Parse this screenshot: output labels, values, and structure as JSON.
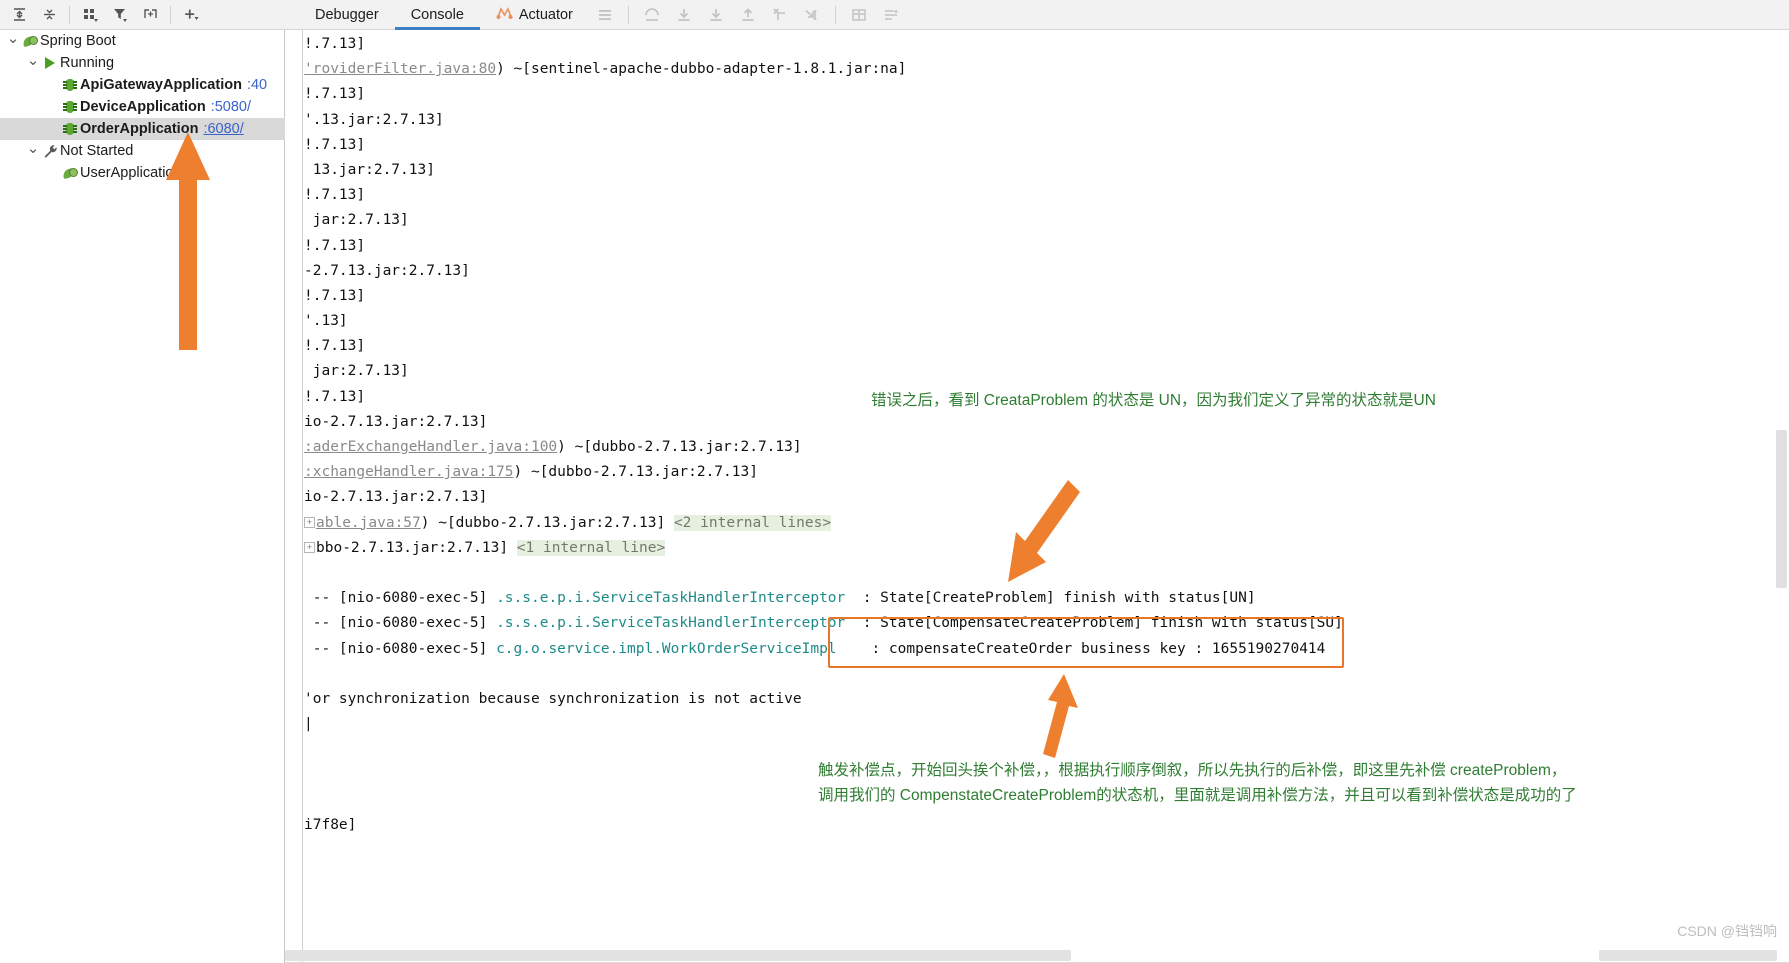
{
  "left_panel": {
    "toolbar": [
      {
        "name": "expand-all-icon",
        "glyph": "expand-all"
      },
      {
        "name": "collapse-all-icon",
        "glyph": "collapse-all"
      },
      {
        "name": "group-by-icon",
        "glyph": "group"
      },
      {
        "name": "filter-icon",
        "glyph": "filter"
      },
      {
        "name": "add-frame-icon",
        "glyph": "add-frame"
      },
      {
        "name": "add-icon",
        "glyph": "plus"
      }
    ],
    "tree": [
      {
        "id": "spring-boot",
        "label": "Spring Boot",
        "icon": "spring-leaf-icon",
        "indent": 0,
        "chevron": "v",
        "bold": false,
        "port": "",
        "selected": false
      },
      {
        "id": "running",
        "label": "Running",
        "icon": "run-play-icon",
        "indent": 1,
        "chevron": "v",
        "bold": false,
        "port": "",
        "selected": false
      },
      {
        "id": "api-gateway-application",
        "label": "ApiGatewayApplication",
        "icon": "debug-bug-icon",
        "indent": 2,
        "chevron": "",
        "bold": true,
        "port": ":40",
        "port_link": false,
        "selected": false
      },
      {
        "id": "device-application",
        "label": "DeviceApplication",
        "icon": "debug-bug-icon",
        "indent": 2,
        "chevron": "",
        "bold": true,
        "port": ":5080/",
        "port_link": false,
        "selected": false
      },
      {
        "id": "order-application",
        "label": "OrderApplication",
        "icon": "debug-bug-icon",
        "indent": 2,
        "chevron": "",
        "bold": true,
        "port": ":6080/",
        "port_link": true,
        "selected": true
      },
      {
        "id": "not-started",
        "label": "Not Started",
        "icon": "wrench-icon",
        "indent": 1,
        "chevron": "v",
        "bold": false,
        "port": "",
        "selected": false
      },
      {
        "id": "user-application",
        "label": "UserApplicatio",
        "icon": "spring-leaf-icon",
        "indent": 2,
        "chevron": "",
        "bold": false,
        "port": "",
        "selected": false
      }
    ]
  },
  "main": {
    "tabs": [
      {
        "id": "debugger",
        "label": "Debugger",
        "active": false,
        "icon": ""
      },
      {
        "id": "console",
        "label": "Console",
        "active": true,
        "icon": ""
      },
      {
        "id": "actuator",
        "label": "Actuator",
        "active": false,
        "icon": "actuator-icon"
      }
    ],
    "toolbar_icons": [
      {
        "name": "menu-icon",
        "glyph": "hamburger"
      },
      {
        "name": "step-out-icon",
        "glyph": "arc-up"
      },
      {
        "name": "step-over-icon",
        "glyph": "arrow-down-bar"
      },
      {
        "name": "step-into-icon",
        "glyph": "arrow-down-bar"
      },
      {
        "name": "force-step-out-icon",
        "glyph": "arrow-up-bar"
      },
      {
        "name": "run-to-cursor-icon",
        "glyph": "x-corner"
      },
      {
        "name": "evaluate-expression-icon",
        "glyph": "arrow-cursor"
      },
      {
        "name": "soft-wrap-icon",
        "glyph": "grid"
      },
      {
        "name": "scroll-to-end-icon",
        "glyph": "lines"
      }
    ],
    "console_lines": [
      {
        "i": 0,
        "fold": false,
        "segs": [
          {
            "t": "!.7.13]"
          }
        ]
      },
      {
        "i": 1,
        "fold": false,
        "segs": [
          {
            "t": "'roviderFilter.java:80",
            "k": "link"
          },
          {
            "t": ") ~[sentinel-apache-dubbo-adapter-1.8.1.jar:na]"
          }
        ]
      },
      {
        "i": 2,
        "fold": false,
        "segs": [
          {
            "t": "!.7.13]"
          }
        ]
      },
      {
        "i": 3,
        "fold": false,
        "segs": [
          {
            "t": "'.13.jar:2.7.13]"
          }
        ]
      },
      {
        "i": 4,
        "fold": false,
        "segs": [
          {
            "t": "!.7.13]"
          }
        ]
      },
      {
        "i": 5,
        "fold": false,
        "segs": [
          {
            "t": " 13.jar:2.7.13]"
          }
        ]
      },
      {
        "i": 6,
        "fold": false,
        "segs": [
          {
            "t": "!.7.13]"
          }
        ]
      },
      {
        "i": 7,
        "fold": false,
        "segs": [
          {
            "t": " jar:2.7.13]"
          }
        ]
      },
      {
        "i": 8,
        "fold": false,
        "segs": [
          {
            "t": "!.7.13]"
          }
        ]
      },
      {
        "i": 9,
        "fold": false,
        "segs": [
          {
            "t": "-2.7.13.jar:2.7.13]"
          }
        ]
      },
      {
        "i": 10,
        "fold": false,
        "segs": [
          {
            "t": "!.7.13]"
          }
        ]
      },
      {
        "i": 11,
        "fold": false,
        "segs": [
          {
            "t": "'.13]"
          }
        ]
      },
      {
        "i": 12,
        "fold": false,
        "segs": [
          {
            "t": "!.7.13]"
          }
        ]
      },
      {
        "i": 13,
        "fold": false,
        "segs": [
          {
            "t": " jar:2.7.13]"
          }
        ]
      },
      {
        "i": 14,
        "fold": false,
        "segs": [
          {
            "t": "!.7.13]"
          }
        ]
      },
      {
        "i": 15,
        "fold": false,
        "segs": [
          {
            "t": "io-2.7.13.jar:2.7.13]"
          }
        ]
      },
      {
        "i": 16,
        "fold": false,
        "segs": [
          {
            "t": ":aderExchangeHandler.java:100",
            "k": "link"
          },
          {
            "t": ") ~[dubbo-2.7.13.jar:2.7.13]"
          }
        ]
      },
      {
        "i": 17,
        "fold": false,
        "segs": [
          {
            "t": ":xchangeHandler.java:175",
            "k": "link"
          },
          {
            "t": ") ~[dubbo-2.7.13.jar:2.7.13]"
          }
        ]
      },
      {
        "i": 18,
        "fold": false,
        "segs": [
          {
            "t": "io-2.7.13.jar:2.7.13]"
          }
        ]
      },
      {
        "i": 19,
        "fold": true,
        "segs": [
          {
            "t": "able.java:57",
            "k": "link"
          },
          {
            "t": ") ~[dubbo-2.7.13.jar:2.7.13] "
          },
          {
            "t": "<2 internal lines>",
            "k": "hl"
          }
        ]
      },
      {
        "i": 20,
        "fold": true,
        "segs": [
          {
            "t": "bbo-2.7.13.jar:2.7.13] "
          },
          {
            "t": "<1 internal line>",
            "k": "hl"
          }
        ]
      },
      {
        "i": 21,
        "fold": false,
        "segs": [
          {
            "t": ""
          }
        ]
      },
      {
        "i": 22,
        "fold": false,
        "segs": [
          {
            "t": " -- [nio-6080-exec-5] "
          },
          {
            "t": ".s.s.e.p.i.ServiceTaskHandlerInterceptor",
            "k": "cyan"
          },
          {
            "t": "  : State[CreateProblem] finish with status[UN]"
          }
        ]
      },
      {
        "i": 23,
        "fold": false,
        "segs": [
          {
            "t": " -- [nio-6080-exec-5] "
          },
          {
            "t": ".s.s.e.p.i.ServiceTaskHandlerInterceptor",
            "k": "cyan"
          },
          {
            "t": "  : State[CompensateCreateProblem] finish with status[SU]"
          }
        ]
      },
      {
        "i": 24,
        "fold": false,
        "segs": [
          {
            "t": " -- [nio-6080-exec-5] "
          },
          {
            "t": "c.g.o.service.impl.WorkOrderServiceImpl",
            "k": "cyan"
          },
          {
            "t": "    : compensateCreateOrder business key : 1655190270414"
          }
        ]
      },
      {
        "i": 25,
        "fold": false,
        "segs": [
          {
            "t": ""
          }
        ]
      },
      {
        "i": 26,
        "fold": false,
        "segs": [
          {
            "t": "'or synchronization because synchronization is not active"
          }
        ]
      },
      {
        "i": 27,
        "fold": false,
        "segs": [
          {
            "t": "|"
          }
        ]
      },
      {
        "i": 28,
        "fold": false,
        "segs": [
          {
            "t": ""
          }
        ]
      },
      {
        "i": 29,
        "fold": false,
        "segs": [
          {
            "t": ""
          }
        ]
      },
      {
        "i": 30,
        "fold": false,
        "segs": [
          {
            "t": ""
          }
        ]
      },
      {
        "i": 31,
        "fold": false,
        "segs": [
          {
            "t": "i7f8e]"
          }
        ]
      }
    ]
  },
  "annotations": {
    "top_note": "错误之后，看到 CreataProblem 的状态是 UN，因为我们定义了异常的状态就是UN",
    "bottom_note_line1": "触发补偿点，开始回头挨个补偿，，根据执行顺序倒叙，所以先执行的后补偿，即这里先补偿 createProblem，",
    "bottom_note_line2": "调用我们的 CompenstateCreateProblem的状态机，里面就是调用补偿方法，并且可以看到补偿状态是成功的了",
    "accent_color": "#e8762a",
    "note_color": "#2f7d32"
  },
  "watermark": "CSDN @铛铛响"
}
